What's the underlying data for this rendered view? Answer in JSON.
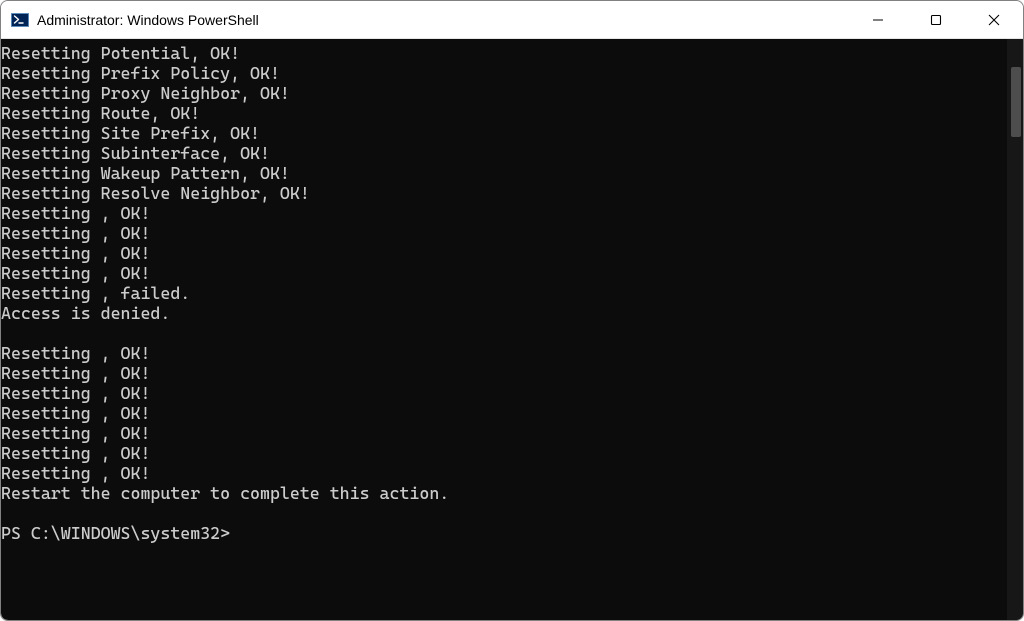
{
  "window": {
    "title": "Administrator: Windows PowerShell"
  },
  "terminal": {
    "lines": [
      "Resetting Potential, OK!",
      "Resetting Prefix Policy, OK!",
      "Resetting Proxy Neighbor, OK!",
      "Resetting Route, OK!",
      "Resetting Site Prefix, OK!",
      "Resetting Subinterface, OK!",
      "Resetting Wakeup Pattern, OK!",
      "Resetting Resolve Neighbor, OK!",
      "Resetting , OK!",
      "Resetting , OK!",
      "Resetting , OK!",
      "Resetting , OK!",
      "Resetting , failed.",
      "Access is denied.",
      "",
      "Resetting , OK!",
      "Resetting , OK!",
      "Resetting , OK!",
      "Resetting , OK!",
      "Resetting , OK!",
      "Resetting , OK!",
      "Resetting , OK!",
      "Restart the computer to complete this action.",
      ""
    ],
    "prompt": "PS C:\\WINDOWS\\system32>"
  }
}
